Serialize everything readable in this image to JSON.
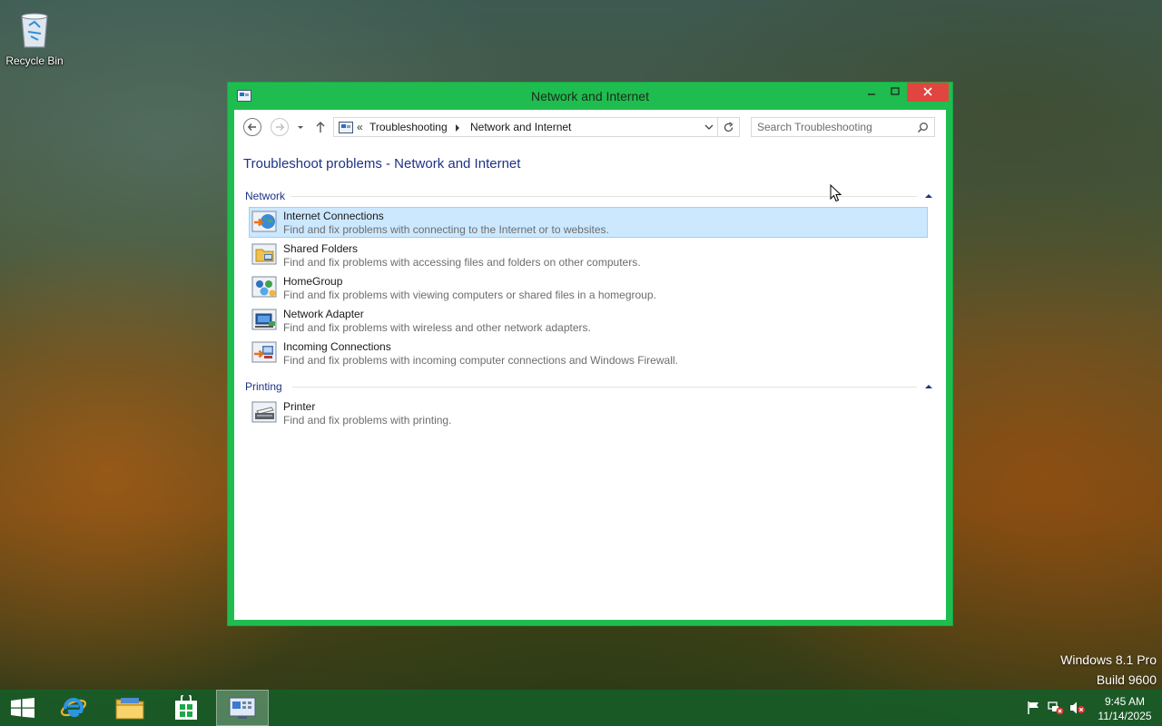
{
  "desktop": {
    "recycle_bin_label": "Recycle Bin"
  },
  "window": {
    "title": "Network and Internet",
    "accent_color": "#1fbd4f",
    "close_color": "#e0463f"
  },
  "address_bar": {
    "overflow": "«",
    "crumbs": [
      "Troubleshooting",
      "Network and Internet"
    ]
  },
  "search": {
    "placeholder": "Search Troubleshooting"
  },
  "page": {
    "heading": "Troubleshoot problems - Network and Internet"
  },
  "groups": [
    {
      "name": "Network",
      "items": [
        {
          "name": "Internet Connections",
          "desc": "Find and fix problems with connecting to the Internet or to websites.",
          "icon": "internet-connections-icon",
          "selected": true
        },
        {
          "name": "Shared Folders",
          "desc": "Find and fix problems with accessing files and folders on other computers.",
          "icon": "shared-folders-icon"
        },
        {
          "name": "HomeGroup",
          "desc": "Find and fix problems with viewing computers or shared files in a homegroup.",
          "icon": "homegroup-icon"
        },
        {
          "name": "Network Adapter",
          "desc": "Find and fix problems with wireless and other network adapters.",
          "icon": "network-adapter-icon"
        },
        {
          "name": "Incoming Connections",
          "desc": "Find and fix problems with incoming computer connections and Windows Firewall.",
          "icon": "incoming-connections-icon"
        }
      ]
    },
    {
      "name": "Printing",
      "items": [
        {
          "name": "Printer",
          "desc": "Find and fix problems with printing.",
          "icon": "printer-icon"
        }
      ]
    }
  ],
  "branding": {
    "edition": "Windows 8.1 Pro",
    "build": "Build 9600"
  },
  "taskbar": {
    "apps": [
      "start-icon",
      "internet-explorer-icon",
      "file-explorer-icon",
      "store-icon",
      "control-panel-icon"
    ],
    "tray_icons": [
      "action-center-flag-icon",
      "network-error-icon",
      "volume-muted-icon"
    ],
    "time": "9:45 AM",
    "date": "11/14/2025"
  }
}
